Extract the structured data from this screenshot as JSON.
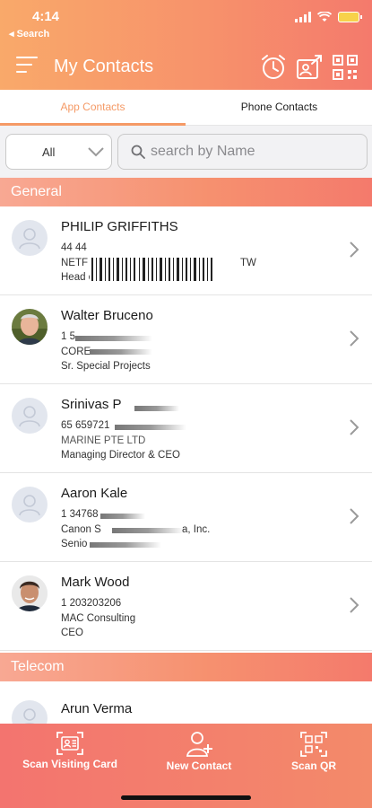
{
  "status_bar": {
    "time": "4:14",
    "back_label": "◂ Search",
    "battery_color": "#f7d24a"
  },
  "header": {
    "title": "My Contacts",
    "menu_icon": "hamburger-menu-icon",
    "actions": [
      "alarm-clock-icon",
      "share-card-icon",
      "qr-code-icon"
    ],
    "gradient_colors": [
      "#f9a96a",
      "#f47a6c"
    ]
  },
  "tabs": [
    {
      "label": "App Contacts",
      "active": true
    },
    {
      "label": "Phone Contacts",
      "active": false
    }
  ],
  "filter": {
    "selected": "All",
    "search_placeholder": "search by Name"
  },
  "sections": [
    {
      "title": "General",
      "contacts": [
        {
          "name": "PHILIP GRIFFITHS",
          "phone": "44 44",
          "company": "NETF",
          "company_suffix": "TW",
          "designation": "Head of EMEA Partnerships",
          "photo": false
        },
        {
          "name": "Walter Bruceno",
          "phone": "1 5",
          "company": "CORE",
          "designation": "Sr. Special Projects",
          "photo": true
        },
        {
          "name": "Srinivas P",
          "phone": "65 659721",
          "company": "MARINE PTE LTD",
          "designation": "Managing Director & CEO",
          "photo": false
        },
        {
          "name": "Aaron Kale",
          "phone": "1 34768",
          "company": "Canon S",
          "company_suffix": "a, Inc.",
          "designation": "Senio",
          "photo": false
        },
        {
          "name": "Mark Wood",
          "phone": "1 203203206",
          "company": "MAC Consulting",
          "designation": "CEO",
          "photo": true
        }
      ]
    },
    {
      "title": "Telecom",
      "contacts": [
        {
          "name": "Arun Verma",
          "photo": false
        }
      ]
    }
  ],
  "bottom_bar": {
    "buttons": [
      {
        "label": "Scan Visiting Card",
        "icon": "scan-card-icon"
      },
      {
        "label": "New Contact",
        "icon": "add-person-icon"
      },
      {
        "label": "Scan QR",
        "icon": "scan-qr-icon"
      }
    ]
  },
  "accent_color": "#f59a66"
}
